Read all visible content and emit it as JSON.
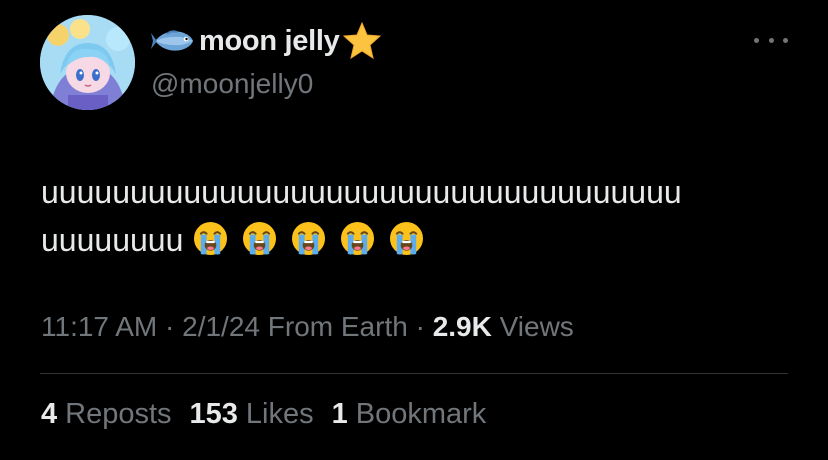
{
  "tweet": {
    "display_name": "moon jelly",
    "handle": "@moonjelly0",
    "name_emoji_left": "fish-icon",
    "name_emoji_right": "star-icon",
    "text_line1": "uuuuuuuuuuuuuuuuuuuuuuuuuuuuuuuuuuuu",
    "text_line2": "uuuuuuuu",
    "emoji_count": 5,
    "emoji_name": "loudly-crying-face",
    "time": "11:17 AM",
    "sep1": " · ",
    "date": "2/1/24",
    "source": " From Earth",
    "sep2": " · ",
    "views_count": "2.9K",
    "views_label": " Views"
  },
  "stats": {
    "reposts_count": "4",
    "reposts_label": "Reposts",
    "likes_count": "153",
    "likes_label": "Likes",
    "bookmarks_count": "1",
    "bookmarks_label": "Bookmark"
  },
  "colors": {
    "background": "#000000",
    "primary_text": "#e7e9ea",
    "secondary_text": "#71767b",
    "divider": "#2f3336"
  }
}
